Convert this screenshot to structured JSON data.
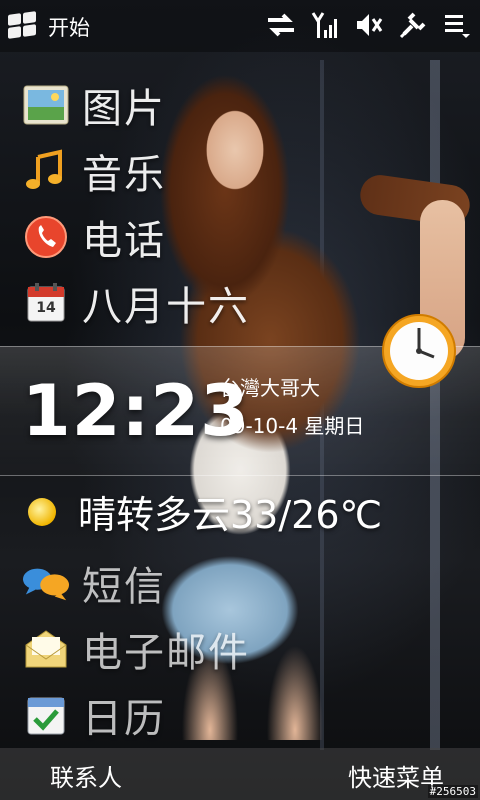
{
  "statusbar": {
    "start_label": "开始",
    "icons": [
      "windows-flag-icon",
      "sync-arrows-icon",
      "signal-icon",
      "volume-mute-icon",
      "power-plug-icon",
      "menu-icon"
    ]
  },
  "launcher": {
    "items": [
      {
        "label": "图片",
        "icon": "pictures-icon"
      },
      {
        "label": "音乐",
        "icon": "music-note-icon"
      },
      {
        "label": "电话",
        "icon": "phone-icon"
      },
      {
        "label": "八月十六",
        "icon": "calendar-day-icon",
        "icon_text": "14"
      }
    ]
  },
  "clock": {
    "time": "12:23",
    "carrier": "台灣大哥大",
    "date": "09-10-4 星期日"
  },
  "weather": {
    "text": "晴转多云33/26℃",
    "icon": "sun-icon"
  },
  "lower_items": [
    {
      "label": "短信",
      "icon": "sms-bubbles-icon"
    },
    {
      "label": "电子邮件",
      "icon": "envelope-icon"
    },
    {
      "label": "日历",
      "icon": "calendar-check-icon"
    }
  ],
  "softkeys": {
    "left": "联系人",
    "right": "快速菜单"
  },
  "watermark": "#256503",
  "colors": {
    "text": "#ffffff",
    "clock_face": "#f5a623"
  }
}
